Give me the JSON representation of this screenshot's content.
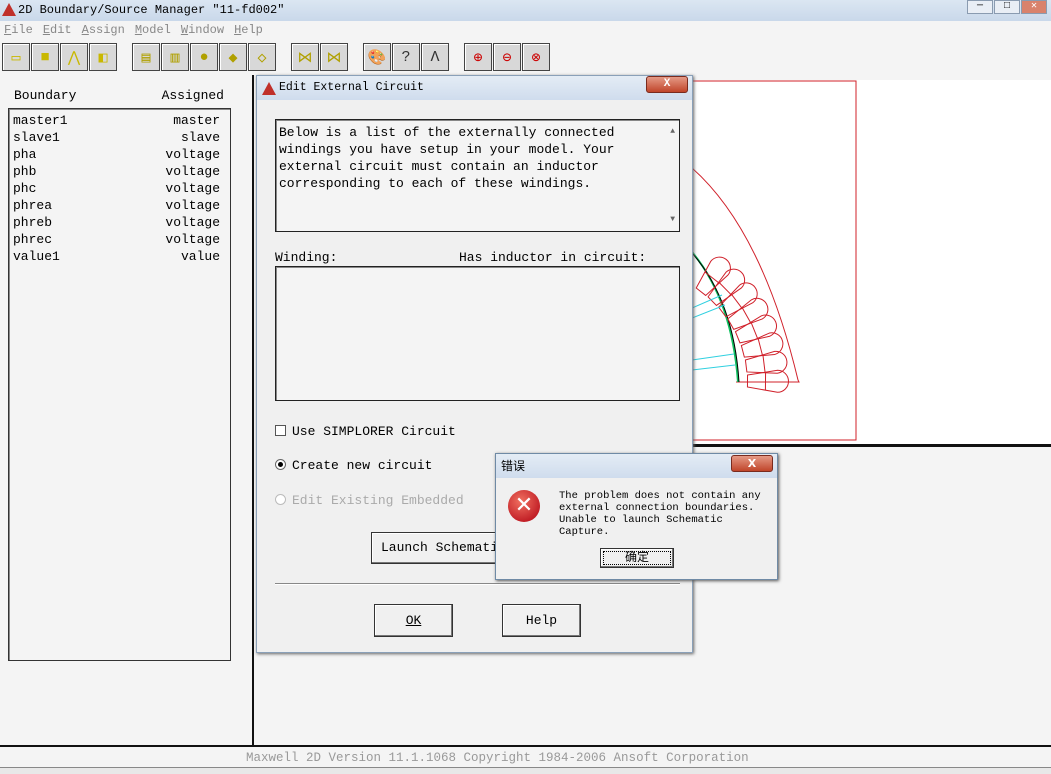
{
  "window": {
    "title": "2D Boundary/Source Manager \"11-fd002\"",
    "minimize": "─",
    "maximize": "□",
    "close": "✕"
  },
  "menu": [
    "File",
    "Edit",
    "Assign",
    "Model",
    "Window",
    "Help"
  ],
  "toolbar": [
    {
      "icon": "rectangle-select-icon",
      "glyph": "▭"
    },
    {
      "icon": "rectangle-icon",
      "glyph": "■"
    },
    {
      "icon": "polyline-icon",
      "glyph": "⋀"
    },
    {
      "icon": "multi-rect-icon",
      "glyph": "◧"
    },
    {
      "icon": "boundary-icon",
      "glyph": "▤"
    },
    {
      "icon": "split-icon",
      "glyph": "▥"
    },
    {
      "icon": "balloon-icon",
      "glyph": "●"
    },
    {
      "icon": "object-3d-icon",
      "glyph": "◆"
    },
    {
      "icon": "diamond-icon",
      "glyph": "◇"
    },
    {
      "icon": "symmetry-icon",
      "glyph": "⋈"
    },
    {
      "icon": "master-slave-icon",
      "glyph": "⋈"
    },
    {
      "icon": "palette-icon",
      "glyph": "🎨"
    },
    {
      "icon": "query-icon",
      "glyph": "?"
    },
    {
      "icon": "compass-icon",
      "glyph": "Λ"
    },
    {
      "icon": "zoom-in-icon",
      "glyph": "⊕"
    },
    {
      "icon": "zoom-out-icon",
      "glyph": "⊖"
    },
    {
      "icon": "zoom-fit-icon",
      "glyph": "⊗"
    }
  ],
  "boundaries": {
    "headers": {
      "name": "Boundary",
      "assigned": "Assigned"
    },
    "rows": [
      [
        "master1",
        "master"
      ],
      [
        "slave1",
        "slave"
      ],
      [
        "pha",
        "voltage"
      ],
      [
        "phb",
        "voltage"
      ],
      [
        "phc",
        "voltage"
      ],
      [
        "phrea",
        "voltage"
      ],
      [
        "phreb",
        "voltage"
      ],
      [
        "phrec",
        "voltage"
      ],
      [
        "value1",
        "value"
      ]
    ]
  },
  "dialog": {
    "title": "Edit External Circuit",
    "close": "X",
    "info": "Below is a list of the externally connected windings you have setup in your model.  Your external circuit must contain an inductor corresponding to each of these windings.",
    "winding_label": "Winding:",
    "inductor_label": "Has inductor in circuit:",
    "use_simplorer": "Use SIMPLORER Circuit",
    "use_simplorer_checked": false,
    "create_new": "Create new circuit",
    "edit_existing": "Edit Existing Embedded",
    "selected": "create_new",
    "launch": "Launch Schematic Capture",
    "ok": "OK",
    "help": "Help"
  },
  "error": {
    "title": "错误",
    "close": "X",
    "message": "The problem does not contain any external connection boundaries. Unable to launch Schematic Capture.",
    "ok": "确定",
    "icon": "error-icon"
  },
  "status": "Maxwell 2D   Version 11.1.1068   Copyright 1984-2006 Ansoft Corporation",
  "colors": {
    "geometry": "#d0202a",
    "airgap": "#10c060",
    "band": "#30d0e0"
  }
}
